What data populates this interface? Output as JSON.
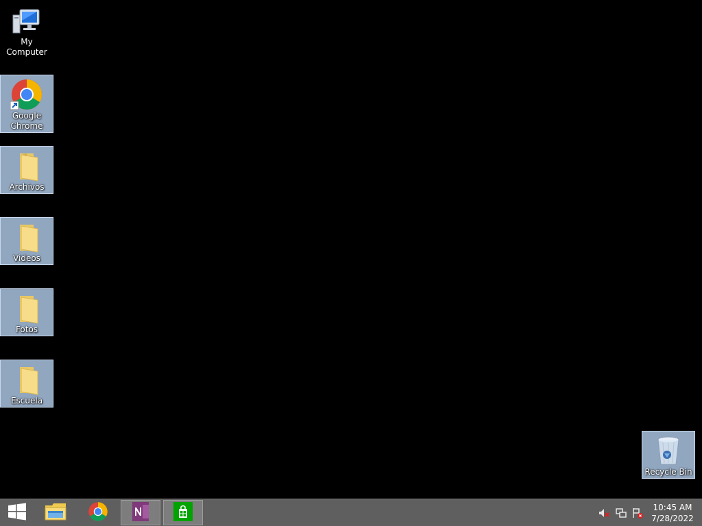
{
  "desktop": {
    "icons": [
      {
        "label": "My Computer",
        "icon": "computer-icon"
      },
      {
        "label": "Google\nChrome",
        "icon": "chrome-icon"
      },
      {
        "label": "Archivos",
        "icon": "folder-icon"
      },
      {
        "label": "Videos",
        "icon": "folder-icon"
      },
      {
        "label": "Fotos",
        "icon": "folder-icon"
      },
      {
        "label": "Escuela",
        "icon": "folder-icon"
      },
      {
        "label": "Recycle Bin",
        "icon": "recycle-bin-icon"
      }
    ]
  },
  "taskbar": {
    "buttons": [
      {
        "name": "start",
        "icon": "windows-logo-icon"
      },
      {
        "name": "file-explorer",
        "icon": "file-explorer-icon"
      },
      {
        "name": "chrome",
        "icon": "chrome-icon"
      },
      {
        "name": "onenote",
        "icon": "onenote-icon"
      },
      {
        "name": "store",
        "icon": "store-icon"
      }
    ],
    "tray": [
      "volume-muted-icon",
      "network-icon",
      "action-center-icon"
    ],
    "clock": {
      "time": "10:45 AM",
      "date": "7/28/2022"
    }
  },
  "colors": {
    "desktop_bg": "#000000",
    "taskbar_bg": "#5f5f5f",
    "selection": "#aac3e1",
    "onenote": "#80397b",
    "store": "#00a300"
  }
}
